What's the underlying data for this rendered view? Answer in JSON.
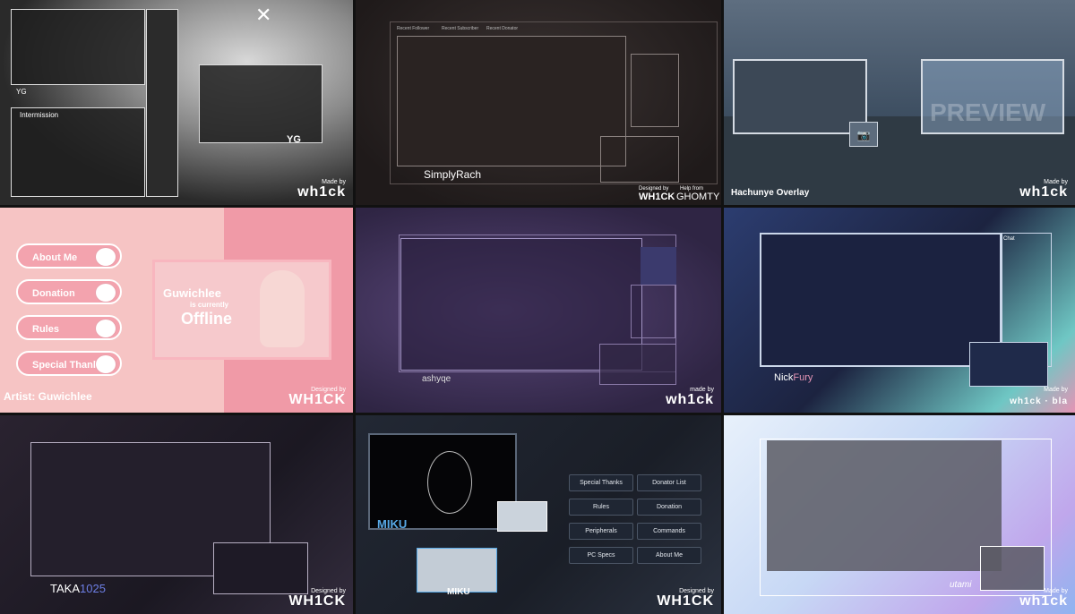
{
  "tiles": [
    {
      "id": "t1",
      "labels": {
        "cam_top": "YG",
        "cam_bottom": "Intermission",
        "cam_right": "YG"
      },
      "credit_small": "Made by",
      "credit_big": "wh1ck"
    },
    {
      "id": "t2",
      "labels": {
        "tab1": "Recent Follower",
        "tab2": "Recent Subscriber",
        "tab3": "Recent Donator",
        "name": "SimplyRach"
      },
      "credit_left_small": "Designed by",
      "credit_left_big": "WH1CK",
      "credit_right_small": "Help from",
      "credit_right_big": "GHOMTY"
    },
    {
      "id": "t3",
      "labels": {
        "title": "Hachunye Overlay",
        "watermark": "PREVIEW"
      },
      "credit_small": "Made by",
      "credit_big": "wh1ck"
    },
    {
      "id": "t4",
      "buttons": [
        "About Me",
        "Donation",
        "Rules",
        "Special Thanks"
      ],
      "labels": {
        "offline_line1": "Guwichlee",
        "offline_line2": "is currently",
        "offline_line3": "Offline",
        "artist": "Artist: Guwichlee"
      },
      "credit_small": "Designed by",
      "credit_big": "WH1CK"
    },
    {
      "id": "t5",
      "labels": {
        "name": "ashyqe"
      },
      "credit_small": "made by",
      "credit_big": "wh1ck"
    },
    {
      "id": "t6",
      "labels": {
        "name_a": "Nick",
        "name_b": "Fury",
        "chat": "Chat"
      },
      "credit_small": "Made by",
      "credit_big": "wh1ck · bla"
    },
    {
      "id": "t7",
      "labels": {
        "name_a": "TAKA",
        "name_b": "1025"
      },
      "credit_small": "Designed by",
      "credit_big": "WH1CK"
    },
    {
      "id": "t8",
      "panel_buttons": [
        "Special Thanks",
        "Donator List",
        "Rules",
        "Donation",
        "Peripherals",
        "Commands",
        "PC Specs",
        "About Me"
      ],
      "labels": {
        "name_top": "MIKU",
        "name_bottom": "MIKU"
      },
      "credit_small": "Designed by",
      "credit_big": "WH1CK"
    },
    {
      "id": "t9",
      "labels": {
        "signature": "utami"
      },
      "credit_small": "Made by",
      "credit_big": "wh1ck"
    }
  ],
  "colors": {
    "pink": "#f3a3ae",
    "accent_blue": "#58a9e6"
  }
}
